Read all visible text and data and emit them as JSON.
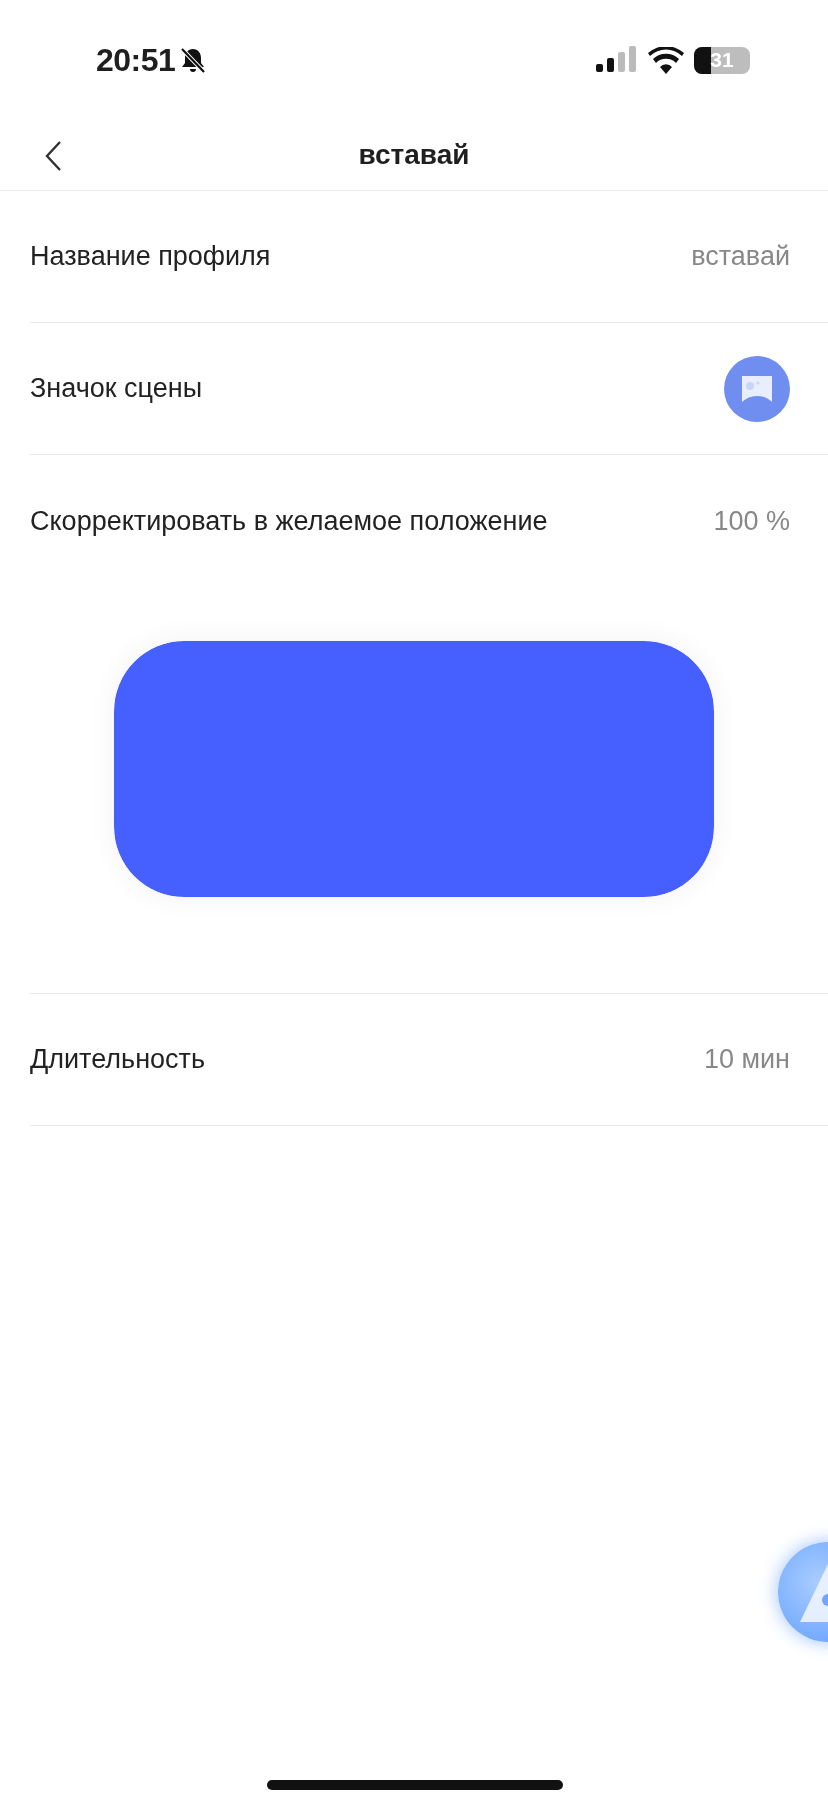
{
  "status_bar": {
    "time": "20:51",
    "battery": "31"
  },
  "nav": {
    "title": "вставай"
  },
  "rows": [
    {
      "kind": "text",
      "label": "Название профиля",
      "value": "вставай"
    },
    {
      "kind": "icon",
      "label": "Значок сцены"
    }
  ],
  "position": {
    "label": "Скорректировать в желаемое положение",
    "value": "100 %",
    "level": 1
  },
  "duration": {
    "label": "Длительность",
    "value": "10 мин"
  }
}
